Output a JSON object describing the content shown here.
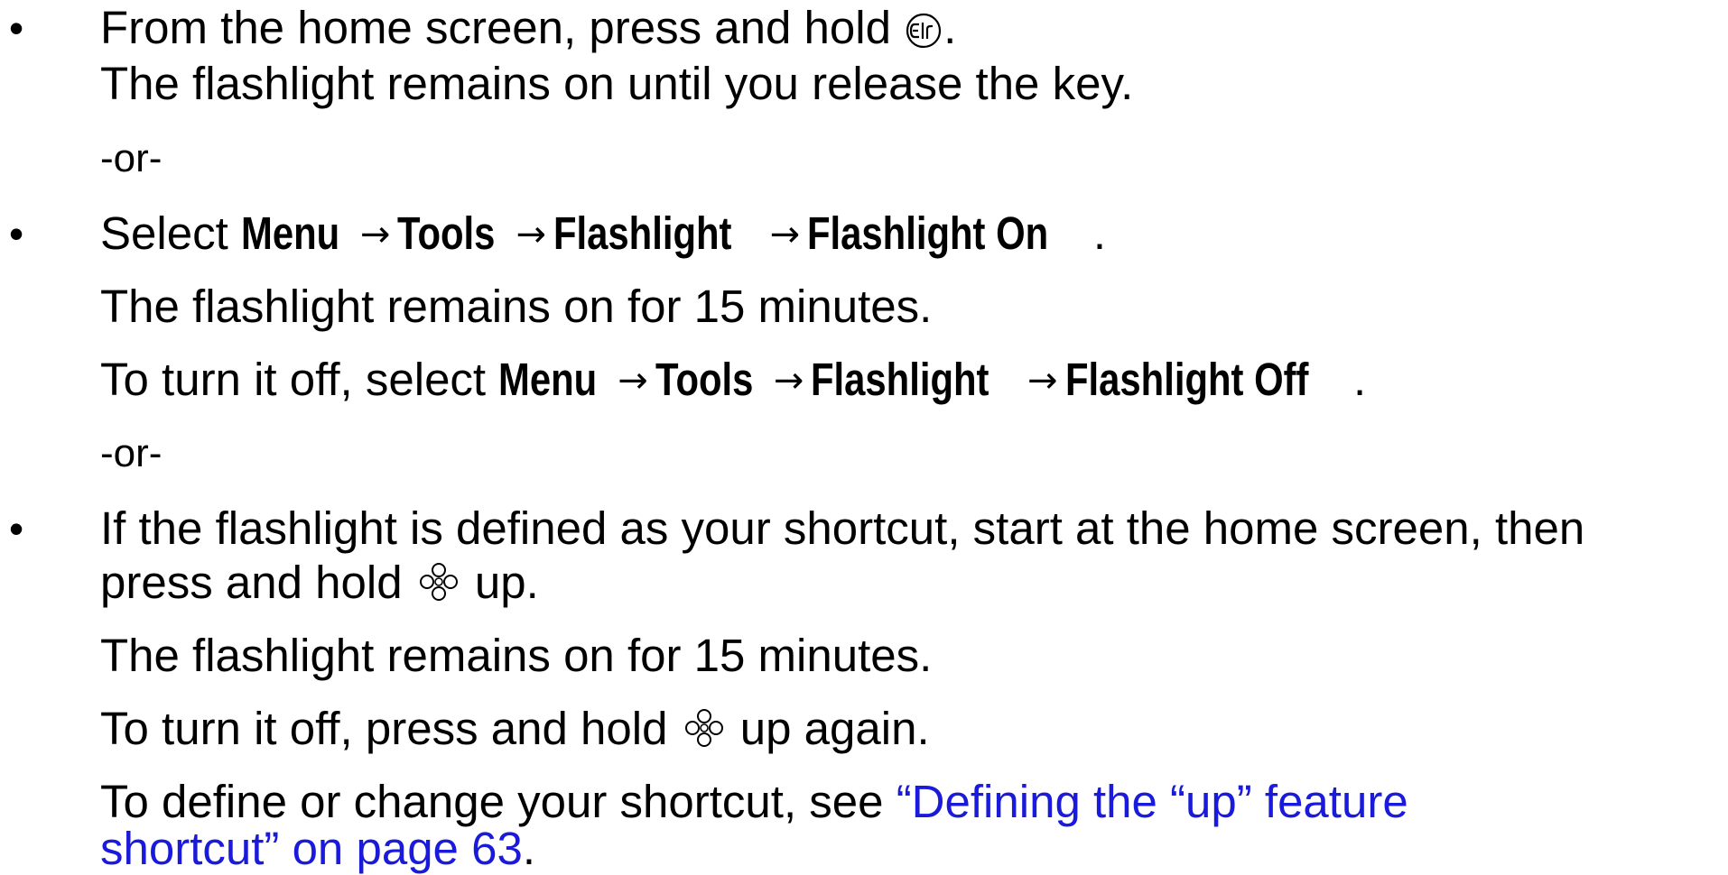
{
  "bullets": [
    "•",
    "•",
    "•"
  ],
  "section1": {
    "line1_prefix": "From the home screen, press and hold",
    "line1_suffix": ".",
    "clr_key_icon": "clr-key-icon",
    "line2": "The flashlight remains on until you release the key."
  },
  "or_text": "-or-",
  "section2": {
    "select": "Select",
    "menu": "Menu",
    "tools": "Tools",
    "flashlight": "Flashlight",
    "flashlight_on": "Flashlight On",
    "period": ".",
    "arrow": "→",
    "duration": "The flashlight remains on for 15 minutes.",
    "turn_off_prefix": "To turn it off, select",
    "flashlight_off": "Flashlight Off"
  },
  "section3": {
    "line1": "If the flashlight is defined as your shortcut, start at the home screen, then",
    "line2_prefix": "press and hold",
    "nav_key_icon": "nav-key-icon",
    "line2_suffix": "up.",
    "duration": "The flashlight remains on for 15 minutes.",
    "turn_off_prefix": "To turn it off, press and hold",
    "turn_off_suffix": "up again.",
    "define_prefix": "To define or change your shortcut, see",
    "link_part1": "“Defining the “up” feature",
    "link_part2": "shortcut” on page 63",
    "define_suffix": "."
  },
  "colors": {
    "text": "#000000",
    "link": "#1a1adb"
  }
}
